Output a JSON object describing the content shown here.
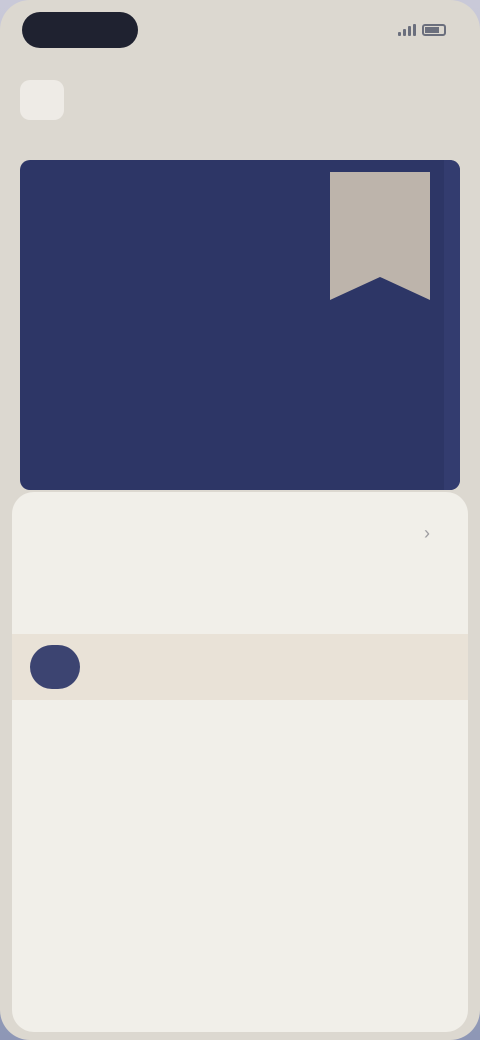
{
  "status": {
    "time": "",
    "right_text": ""
  },
  "top_nav": {
    "items": [
      {
        "label": ""
      },
      {
        "label": ""
      },
      {
        "label": ""
      }
    ]
  },
  "hero": {
    "title": "",
    "subtitle": "",
    "badge": "",
    "colors": {
      "background": "#2d3666",
      "badge": "#bdb4ab"
    }
  },
  "sheet": {
    "tabs": [
      {
        "label": ""
      },
      {
        "label": ""
      }
    ],
    "section_label": "",
    "rows": [
      {
        "avatar_text": "",
        "text": ""
      }
    ]
  },
  "icons": {
    "chevron": "chevron-right-icon"
  }
}
